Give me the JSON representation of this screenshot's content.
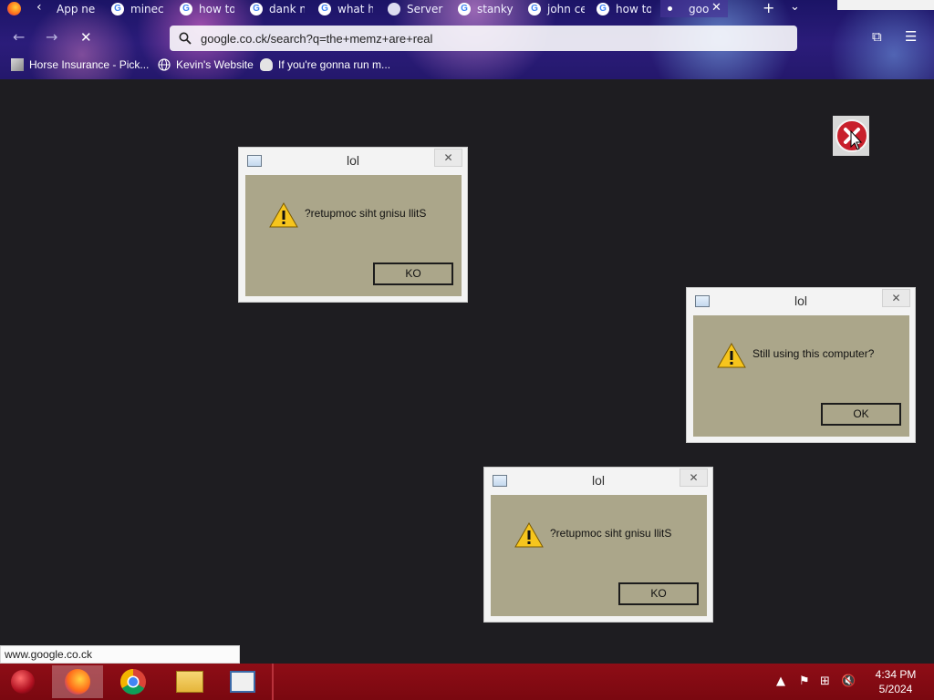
{
  "browser": {
    "tabs": [
      {
        "label": "App ne"
      },
      {
        "label": "minec"
      },
      {
        "label": "how to"
      },
      {
        "label": "dank n"
      },
      {
        "label": "what h"
      },
      {
        "label": "Server I"
      },
      {
        "label": "stanky"
      },
      {
        "label": "john ce"
      },
      {
        "label": "how to"
      },
      {
        "label": "goo"
      }
    ],
    "url": "google.co.ck/search?q=the+memz+are+real",
    "bookmarks": [
      {
        "label": "Horse Insurance - Pick..."
      },
      {
        "label": "Kevin's Website"
      },
      {
        "label": "If you're gonna run m..."
      }
    ],
    "status_url": "www.google.co.ck"
  },
  "dialogs": [
    {
      "title": "lol",
      "message": "?retupmoc siht gnisu llitS",
      "button": "KO",
      "close": "✕"
    },
    {
      "title": "lol",
      "message": "Still using this computer?",
      "button": "OK",
      "close": "✕"
    },
    {
      "title": "lol",
      "message": "?retupmoc siht gnisu llitS",
      "button": "KO",
      "close": "✕"
    }
  ],
  "taskbar": {
    "time": "4:34 PM",
    "date": "5/2024"
  },
  "colors": {
    "dialog_body": "#aba68a",
    "taskbar": "#8e0d16",
    "page_background": "#1e1d21"
  }
}
